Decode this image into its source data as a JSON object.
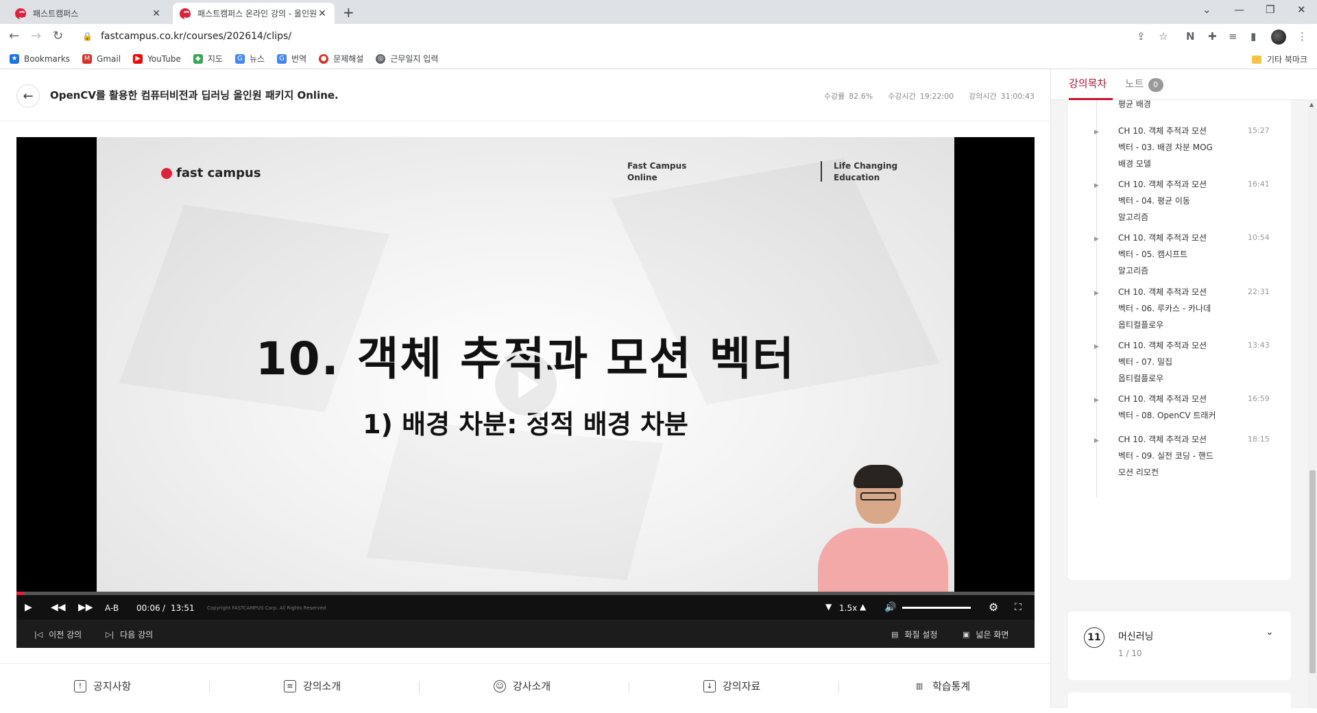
{
  "browser": {
    "tabs": [
      {
        "title": "패스트캠퍼스",
        "close": "✕"
      },
      {
        "title": "패스트캠퍼스 온라인 강의 - 올인원",
        "close": "✕"
      }
    ],
    "new_tab": "+",
    "url": "fastcampus.co.kr/courses/202614/clips/",
    "bookmarks": [
      {
        "label": "Bookmarks",
        "icon": "star-icon",
        "color": "#1a73e8"
      },
      {
        "label": "Gmail",
        "icon": "gmail-icon",
        "color": "#d93025"
      },
      {
        "label": "YouTube",
        "icon": "youtube-icon",
        "color": "#ff0000"
      },
      {
        "label": "지도",
        "icon": "maps-icon",
        "color": "#34a853"
      },
      {
        "label": "뉴스",
        "icon": "news-icon",
        "color": "#4285f4"
      },
      {
        "label": "번역",
        "icon": "translate-icon",
        "color": "#4285f4"
      },
      {
        "label": "문제해설",
        "icon": "bookmark-site-icon",
        "color": "#d93025"
      },
      {
        "label": "근무일지 입력",
        "icon": "globe-icon",
        "color": "#5f6368"
      }
    ],
    "other_bookmarks": "기타 북마크"
  },
  "course": {
    "title": "OpenCV를 활용한 컴퓨터비전과 딥러닝 올인원 패키지 Online.",
    "stats": [
      {
        "label": "수강률",
        "value": "82.6%"
      },
      {
        "label": "수강시간",
        "value": "19:22:00"
      },
      {
        "label": "강의시간",
        "value": "31:00:43"
      }
    ]
  },
  "video": {
    "logo_text": "fast campus",
    "tagline_left": [
      "Fast Campus",
      "Online"
    ],
    "tagline_right": [
      "Life Changing",
      "Education"
    ],
    "slide_title": "10. 객체 추적과 모션 벡터",
    "slide_subtitle": "1) 배경 차분: 정적 배경 차분",
    "progress_fraction": 0.008,
    "controls": {
      "ab": "A-B",
      "current_time": "00:06",
      "separator": "/",
      "duration": "13:51",
      "speed": "1.5x",
      "copyright": "Copyright FASTCAMPUS Corp. All Rights Reserved"
    },
    "sub_controls": {
      "prev": "이전 강의",
      "next": "다음 강의",
      "quality": "화질 설정",
      "wide": "넓은 화면"
    }
  },
  "bottom_nav": [
    {
      "label": "공지사항"
    },
    {
      "label": "강의소개"
    },
    {
      "label": "강사소개"
    },
    {
      "label": "강의자료"
    },
    {
      "label": "학습통계"
    }
  ],
  "sidebar": {
    "tab_active": "강의목차",
    "tab_notes": "노트",
    "notes_count": "0",
    "partial_line": "평균 배경",
    "clips": [
      {
        "lines": [
          "CH 10. 객체 추적과 모션",
          "벡터 - 03. 배경 차분 MOG",
          "배경 모델"
        ],
        "time": "15:27"
      },
      {
        "lines": [
          "CH 10. 객체 추적과 모션",
          "벡터 - 04. 평균 이동",
          "알고리즘"
        ],
        "time": "16:41"
      },
      {
        "lines": [
          "CH 10. 객체 추적과 모션",
          "벡터 - 05. 캠시프트",
          "알고리즘"
        ],
        "time": "10:54"
      },
      {
        "lines": [
          "CH 10. 객체 추적과 모션",
          "벡터 - 06. 루카스 - 카나데",
          "옵티컬플로우"
        ],
        "time": "22:31"
      },
      {
        "lines": [
          "CH 10. 객체 추적과 모션",
          "벡터 - 07. 밀집",
          "옵티컬플로우"
        ],
        "time": "13:43"
      },
      {
        "lines": [
          "CH 10. 객체 추적과 모션",
          "벡터 - 08. OpenCV 트래커"
        ],
        "time": "16:59"
      },
      {
        "lines": [
          "CH 10. 객체 추적과 모션",
          "벡터 - 09. 실전 코딩 - 핸드",
          "모션 리모컨"
        ],
        "time": "18:15"
      }
    ],
    "chapter": {
      "number": "11",
      "name": "머신러닝",
      "done": "1",
      "sep": "/",
      "total": "10"
    }
  },
  "colors": {
    "accent": "#c8102e",
    "brand": "#e0213a"
  }
}
